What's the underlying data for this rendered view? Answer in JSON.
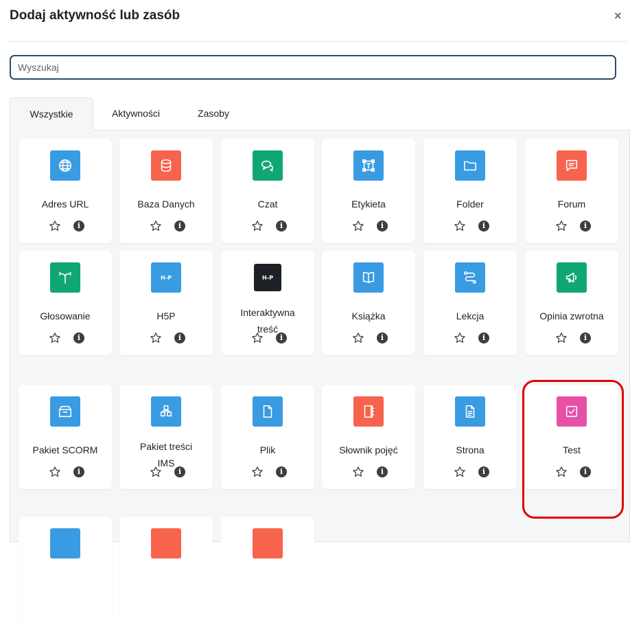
{
  "modal": {
    "title": "Dodaj aktywność lub zasób",
    "close_glyph": "×"
  },
  "search": {
    "placeholder": "Wyszukaj"
  },
  "tabs": [
    {
      "label": "Wszystkie",
      "active": true
    },
    {
      "label": "Aktywności",
      "active": false
    },
    {
      "label": "Zasoby",
      "active": false
    }
  ],
  "modules": [
    {
      "name": "Adres URL",
      "icon": "globe-icon",
      "color": "#399be2"
    },
    {
      "name": "Baza Danych",
      "icon": "database-icon",
      "color": "#f7634d"
    },
    {
      "name": "Czat",
      "icon": "chat-icon",
      "color": "#11a676"
    },
    {
      "name": "Etykieta",
      "icon": "label-icon",
      "color": "#399be2"
    },
    {
      "name": "Folder",
      "icon": "folder-icon",
      "color": "#399be2"
    },
    {
      "name": "Forum",
      "icon": "forum-icon",
      "color": "#f7634d"
    },
    {
      "name": "Głosowanie",
      "icon": "choice-icon",
      "color": "#11a676"
    },
    {
      "name": "H5P",
      "icon": "h5p-icon",
      "color": "#399be2"
    },
    {
      "name": "Interaktywna treść",
      "icon": "h5p-dark-icon",
      "color": "#1d2125"
    },
    {
      "name": "Książka",
      "icon": "book-icon",
      "color": "#399be2"
    },
    {
      "name": "Lekcja",
      "icon": "lesson-icon",
      "color": "#399be2"
    },
    {
      "name": "Opinia zwrotna",
      "icon": "megaphone-icon",
      "color": "#11a676"
    },
    {
      "name": "Pakiet SCORM",
      "icon": "box-icon",
      "color": "#399be2"
    },
    {
      "name": "Pakiet treści IMS",
      "icon": "ims-icon",
      "color": "#399be2"
    },
    {
      "name": "Plik",
      "icon": "file-icon",
      "color": "#399be2"
    },
    {
      "name": "Słownik pojęć",
      "icon": "glossary-icon",
      "color": "#f7634d"
    },
    {
      "name": "Strona",
      "icon": "page-icon",
      "color": "#399be2"
    },
    {
      "name": "Test",
      "icon": "quiz-icon",
      "color": "#e650a8",
      "highlighted": true
    }
  ],
  "partial_row_colors": [
    "#399be2",
    "#f7634d",
    "#f7634d"
  ],
  "colors": {
    "highlight": "#e00000",
    "search_border": "#2f4b66",
    "panel_bg": "#f5f6f7"
  }
}
